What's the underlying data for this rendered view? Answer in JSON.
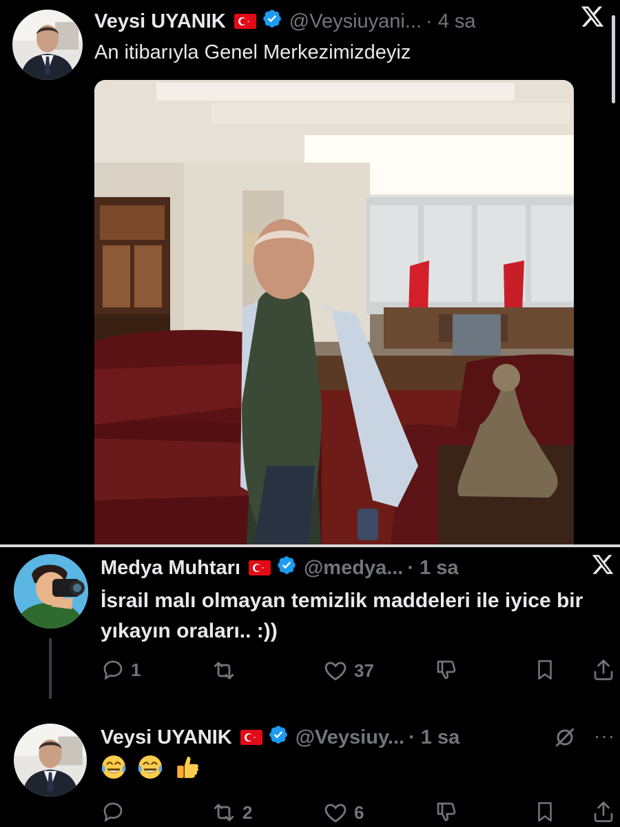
{
  "tweet1": {
    "author_name": "Veysi UYANIK",
    "handle": "@Veysiuyani...",
    "time": "· 4 sa",
    "text": "An itibarıyla Genel Merkezimizdeyiz",
    "x_label": "X"
  },
  "tweet2": {
    "author_name": "Medya Muhtarı",
    "handle": "@medya...",
    "time": "· 1 sa",
    "text": "İsrail malı olmayan temizlik maddeleri ile iyice bir yıkayın oraları.. :))",
    "x_label": "X",
    "stats": {
      "replies": "1",
      "reposts": "",
      "likes": "37"
    }
  },
  "tweet3": {
    "author_name": "Veysi UYANIK",
    "handle": "@Veysiuy...",
    "time": "· 1 sa",
    "text_emoji": [
      "tears-of-joy",
      "tears-of-joy",
      "thumbs-up"
    ],
    "more_label": "···",
    "stats": {
      "replies": "",
      "reposts": "2",
      "likes": "6"
    }
  },
  "colors": {
    "background": "#000000",
    "text": "#e7e9ea",
    "muted": "#71767b",
    "verified": "#1d9bf0",
    "flag_red": "#e30a17"
  }
}
